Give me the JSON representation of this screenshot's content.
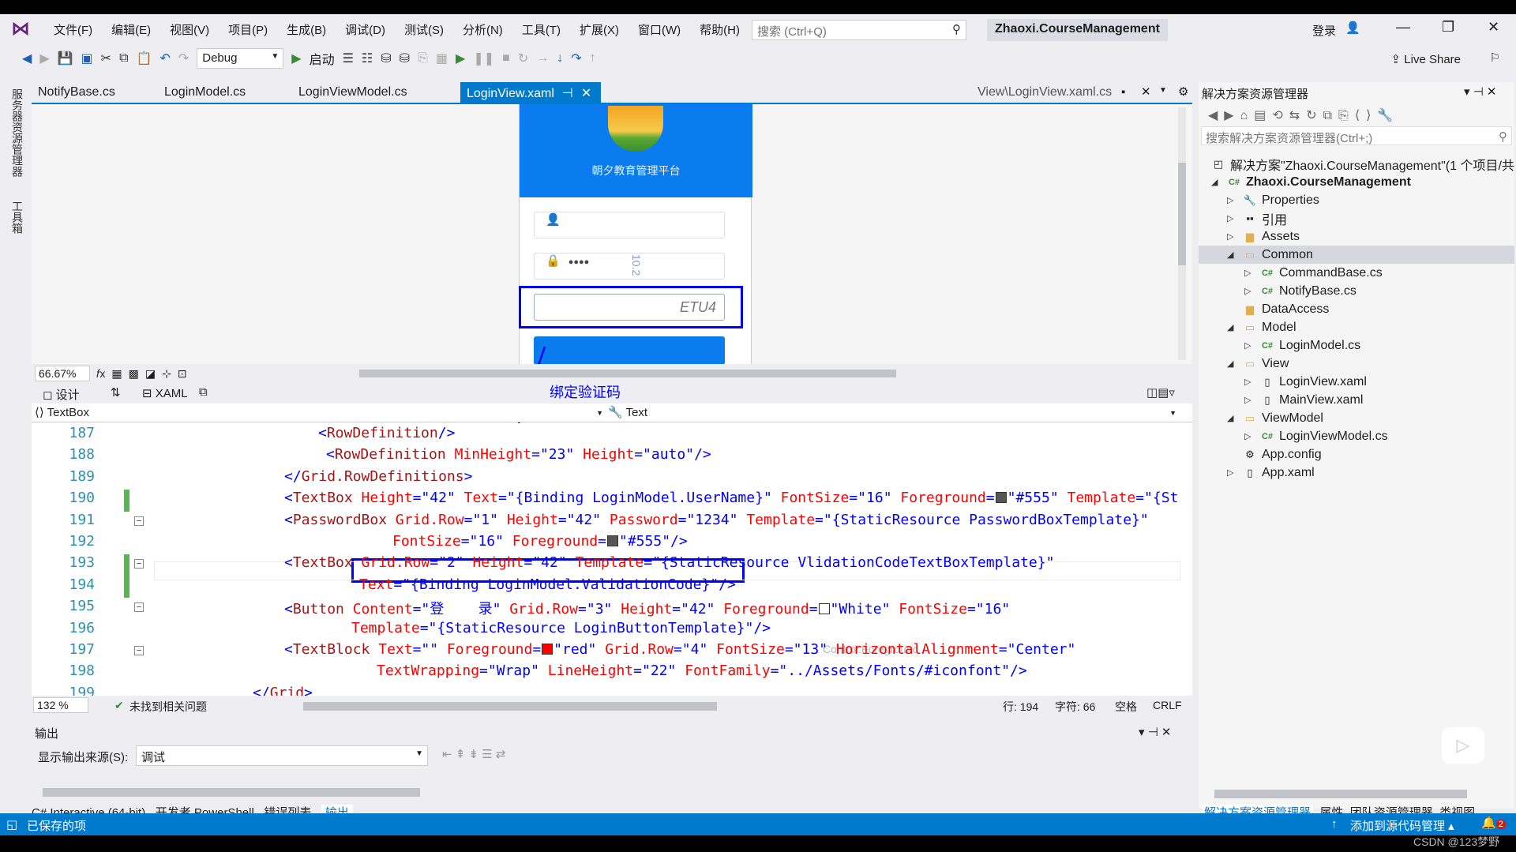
{
  "menu": [
    "文件(F)",
    "编辑(E)",
    "视图(V)",
    "项目(P)",
    "生成(B)",
    "调试(D)",
    "测试(S)",
    "分析(N)",
    "工具(T)",
    "扩展(X)",
    "窗口(W)",
    "帮助(H)"
  ],
  "search_placeholder": "搜索 (Ctrl+Q)",
  "solution_title": "Zhaoxi.CourseManagement",
  "login": "登录",
  "toolbar": {
    "config": "Debug",
    "start": "启动",
    "live_share": "Live Share"
  },
  "side_strip": [
    "服务器资源管理器",
    "工具箱"
  ],
  "tabs": [
    "NotifyBase.cs",
    "LoginModel.cs",
    "LoginViewModel.cs",
    "LoginView.xaml"
  ],
  "tab_right": "View\\LoginView.xaml.cs",
  "designer": {
    "app_title": "朝夕教育管理平台",
    "password_dots": "●●●●",
    "dimension": "10.2",
    "captcha": "ETU4",
    "annotation": "绑定验证码",
    "zoom": "66.67%",
    "design_tab": "设计",
    "xaml_tab": "XAML"
  },
  "nav": {
    "element": "TextBox",
    "property": "Text"
  },
  "code_lines": [
    {
      "n": "187",
      "t": [
        [
          "b",
          "<"
        ],
        [
          "e",
          "RowDefinition"
        ],
        [
          "b",
          "/>"
        ]
      ]
    },
    {
      "n": "188",
      "t": [
        [
          "b",
          "<"
        ],
        [
          "e",
          "RowDefinition"
        ],
        [
          "a",
          " MinHeight"
        ],
        [
          "b",
          "=\""
        ],
        [
          "v",
          "23"
        ],
        [
          "b",
          "\""
        ],
        [
          "a",
          " Height"
        ],
        [
          "b",
          "=\""
        ],
        [
          "v",
          "auto"
        ],
        [
          "b",
          "\"/>"
        ]
      ]
    },
    {
      "n": "189",
      "t": [
        [
          "b",
          "</"
        ],
        [
          "e",
          "Grid.RowDefinitions"
        ],
        [
          "b",
          ">"
        ]
      ]
    },
    {
      "n": "190",
      "t": [
        [
          "b",
          "<"
        ],
        [
          "e",
          "TextBox"
        ],
        [
          "a",
          " Height"
        ],
        [
          "b",
          "=\""
        ],
        [
          "v",
          "42"
        ],
        [
          "b",
          "\""
        ],
        [
          "a",
          " Text"
        ],
        [
          "b",
          "=\""
        ],
        [
          "v",
          "{Binding LoginModel.UserName}"
        ],
        [
          "b",
          "\""
        ],
        [
          "a",
          " FontSize"
        ],
        [
          "b",
          "=\""
        ],
        [
          "v",
          "16"
        ],
        [
          "b",
          "\""
        ],
        [
          "a",
          " Foreground"
        ],
        [
          "b",
          "="
        ],
        [
          "sw",
          "#555555"
        ],
        [
          "b",
          "\""
        ],
        [
          "v",
          "#555"
        ],
        [
          "b",
          "\""
        ],
        [
          "a",
          " Template"
        ],
        [
          "b",
          "=\""
        ],
        [
          "v",
          "{St"
        ]
      ]
    },
    {
      "n": "191",
      "t": [
        [
          "b",
          "<"
        ],
        [
          "e",
          "PasswordBox"
        ],
        [
          "a",
          " Grid.Row"
        ],
        [
          "b",
          "=\""
        ],
        [
          "v",
          "1"
        ],
        [
          "b",
          "\""
        ],
        [
          "a",
          " Height"
        ],
        [
          "b",
          "=\""
        ],
        [
          "v",
          "42"
        ],
        [
          "b",
          "\""
        ],
        [
          "a",
          " Password"
        ],
        [
          "b",
          "=\""
        ],
        [
          "v",
          "1234"
        ],
        [
          "b",
          "\""
        ],
        [
          "a",
          " Template"
        ],
        [
          "b",
          "=\""
        ],
        [
          "v",
          "{StaticResource PasswordBoxTemplate}"
        ],
        [
          "b",
          "\""
        ]
      ]
    },
    {
      "n": "192",
      "t": [
        [
          "a",
          "FontSize"
        ],
        [
          "b",
          "=\""
        ],
        [
          "v",
          "16"
        ],
        [
          "b",
          "\""
        ],
        [
          "a",
          " Foreground"
        ],
        [
          "b",
          "="
        ],
        [
          "sw",
          "#555555"
        ],
        [
          "b",
          "\""
        ],
        [
          "v",
          "#555"
        ],
        [
          "b",
          "\"/>"
        ]
      ]
    },
    {
      "n": "193",
      "t": [
        [
          "b",
          "<"
        ],
        [
          "e",
          "TextBox"
        ],
        [
          "a",
          " Grid.Row"
        ],
        [
          "b",
          "=\""
        ],
        [
          "v",
          "2"
        ],
        [
          "b",
          "\""
        ],
        [
          "a",
          " Height"
        ],
        [
          "b",
          "=\""
        ],
        [
          "v",
          "42"
        ],
        [
          "b",
          "\""
        ],
        [
          "a",
          " Template"
        ],
        [
          "b",
          "=\""
        ],
        [
          "v",
          "{StaticResource VlidationCodeTextBoxTemplate}"
        ],
        [
          "b",
          "\""
        ]
      ]
    },
    {
      "n": "194",
      "t": [
        [
          "a",
          "Text"
        ],
        [
          "b",
          "=\""
        ],
        [
          "v",
          "{Binding LoginModel.ValidationCode}"
        ],
        [
          "b",
          "\"/>"
        ]
      ]
    },
    {
      "n": "195",
      "t": [
        [
          "b",
          "<"
        ],
        [
          "e",
          "Button"
        ],
        [
          "a",
          " Content"
        ],
        [
          "b",
          "=\""
        ],
        [
          "v",
          "登    录"
        ],
        [
          "b",
          "\""
        ],
        [
          "a",
          " Grid.Row"
        ],
        [
          "b",
          "=\""
        ],
        [
          "v",
          "3"
        ],
        [
          "b",
          "\""
        ],
        [
          "a",
          " Height"
        ],
        [
          "b",
          "=\""
        ],
        [
          "v",
          "42"
        ],
        [
          "b",
          "\""
        ],
        [
          "a",
          " Foreground"
        ],
        [
          "b",
          "="
        ],
        [
          "sw",
          "#ffffff"
        ],
        [
          "b",
          "\""
        ],
        [
          "v",
          "White"
        ],
        [
          "b",
          "\""
        ],
        [
          "a",
          " FontSize"
        ],
        [
          "b",
          "=\""
        ],
        [
          "v",
          "16"
        ],
        [
          "b",
          "\""
        ]
      ]
    },
    {
      "n": "196",
      "t": [
        [
          "a",
          "Template"
        ],
        [
          "b",
          "=\""
        ],
        [
          "v",
          "{StaticResource LoginButtonTemplate}"
        ],
        [
          "b",
          "\"/>"
        ]
      ]
    },
    {
      "n": "197",
      "t": [
        [
          "b",
          "<"
        ],
        [
          "e",
          "TextBlock"
        ],
        [
          "a",
          " Text"
        ],
        [
          "b",
          "=\"\""
        ],
        [
          "a",
          " Foreground"
        ],
        [
          "b",
          "="
        ],
        [
          "sw",
          "#ff0000"
        ],
        [
          "b",
          "\""
        ],
        [
          "v",
          "red"
        ],
        [
          "b",
          "\""
        ],
        [
          "a",
          " Grid.Row"
        ],
        [
          "b",
          "=\""
        ],
        [
          "v",
          "4"
        ],
        [
          "b",
          "\""
        ],
        [
          "a",
          " FontSize"
        ],
        [
          "b",
          "=\""
        ],
        [
          "v",
          "13"
        ],
        [
          "b",
          "\""
        ],
        [
          "a",
          " HorizontalAlignment"
        ],
        [
          "b",
          "=\""
        ],
        [
          "v",
          "Center"
        ],
        [
          "b",
          "\""
        ]
      ]
    },
    {
      "n": "198",
      "t": [
        [
          "a",
          "TextWrapping"
        ],
        [
          "b",
          "=\""
        ],
        [
          "v",
          "Wrap"
        ],
        [
          "b",
          "\""
        ],
        [
          "a",
          " LineHeight"
        ],
        [
          "b",
          "=\""
        ],
        [
          "v",
          "22"
        ],
        [
          "b",
          "\""
        ],
        [
          "a",
          " FontFamily"
        ],
        [
          "b",
          "=\""
        ],
        [
          "v",
          "../Assets/Fonts/#iconfont"
        ],
        [
          "b",
          "\"/>"
        ]
      ]
    },
    {
      "n": "199",
      "t": [
        [
          "b",
          "</"
        ],
        [
          "e",
          "Grid"
        ],
        [
          "b",
          ">"
        ]
      ]
    }
  ],
  "tooltip": "Control.Foreground",
  "status": {
    "zoom": "132 %",
    "issues": "未找到相关问题",
    "line": "行: 194",
    "char": "字符: 66",
    "space": "空格",
    "eol": "CRLF"
  },
  "output": {
    "title": "输出",
    "source_label": "显示输出来源(S):",
    "source_value": "调试"
  },
  "bottom_tabs": [
    "C# Interactive (64-bit)",
    "开发者 PowerShell",
    "错误列表",
    "输出"
  ],
  "statusbar": {
    "saved": "已保存的项",
    "source_control": "添加到源代码管理",
    "notifications": "2"
  },
  "watermark": "CSDN @123梦野",
  "solution_explorer": {
    "title": "解决方案资源管理器",
    "search_placeholder": "搜索解决方案资源管理器(Ctrl+;)",
    "items": [
      {
        "label": "解决方案\"Zhaoxi.CourseManagement\"(1 个项目/共",
        "icon": "solution-icon",
        "level": 0,
        "exp": ""
      },
      {
        "label": "Zhaoxi.CourseManagement",
        "icon": "csproj-icon",
        "level": 0,
        "exp": "open",
        "bold": true
      },
      {
        "label": "Properties",
        "icon": "wrench-icon",
        "level": 1,
        "exp": "closed"
      },
      {
        "label": "引用",
        "icon": "references-icon",
        "level": 1,
        "exp": "closed"
      },
      {
        "label": "Assets",
        "icon": "folder-icon",
        "level": 1,
        "exp": "closed"
      },
      {
        "label": "Common",
        "icon": "folder-open-icon",
        "level": 1,
        "exp": "open",
        "selected": true
      },
      {
        "label": "CommandBase.cs",
        "icon": "csharp-file-icon",
        "level": 2,
        "exp": "closed"
      },
      {
        "label": "NotifyBase.cs",
        "icon": "csharp-file-icon",
        "level": 2,
        "exp": "closed"
      },
      {
        "label": "DataAccess",
        "icon": "folder-icon",
        "level": 1,
        "exp": ""
      },
      {
        "label": "Model",
        "icon": "folder-open-icon",
        "level": 1,
        "exp": "open"
      },
      {
        "label": "LoginModel.cs",
        "icon": "csharp-file-icon",
        "level": 2,
        "exp": "closed"
      },
      {
        "label": "View",
        "icon": "folder-open-icon",
        "level": 1,
        "exp": "open"
      },
      {
        "label": "LoginView.xaml",
        "icon": "xaml-file-icon",
        "level": 2,
        "exp": "closed"
      },
      {
        "label": "MainView.xaml",
        "icon": "xaml-file-icon",
        "level": 2,
        "exp": "closed"
      },
      {
        "label": "ViewModel",
        "icon": "folder-open-icon",
        "level": 1,
        "exp": "open"
      },
      {
        "label": "LoginViewModel.cs",
        "icon": "csharp-file-icon",
        "level": 2,
        "exp": "closed"
      },
      {
        "label": "App.config",
        "icon": "config-file-icon",
        "level": 1,
        "exp": ""
      },
      {
        "label": "App.xaml",
        "icon": "xaml-file-icon",
        "level": 1,
        "exp": "closed"
      }
    ],
    "bottom_tabs": [
      "解决方案资源管理器",
      "属性",
      "团队资源管理器",
      "类视图"
    ]
  },
  "colors": {
    "accent": "#007acc",
    "annotation": "#0000ff"
  }
}
